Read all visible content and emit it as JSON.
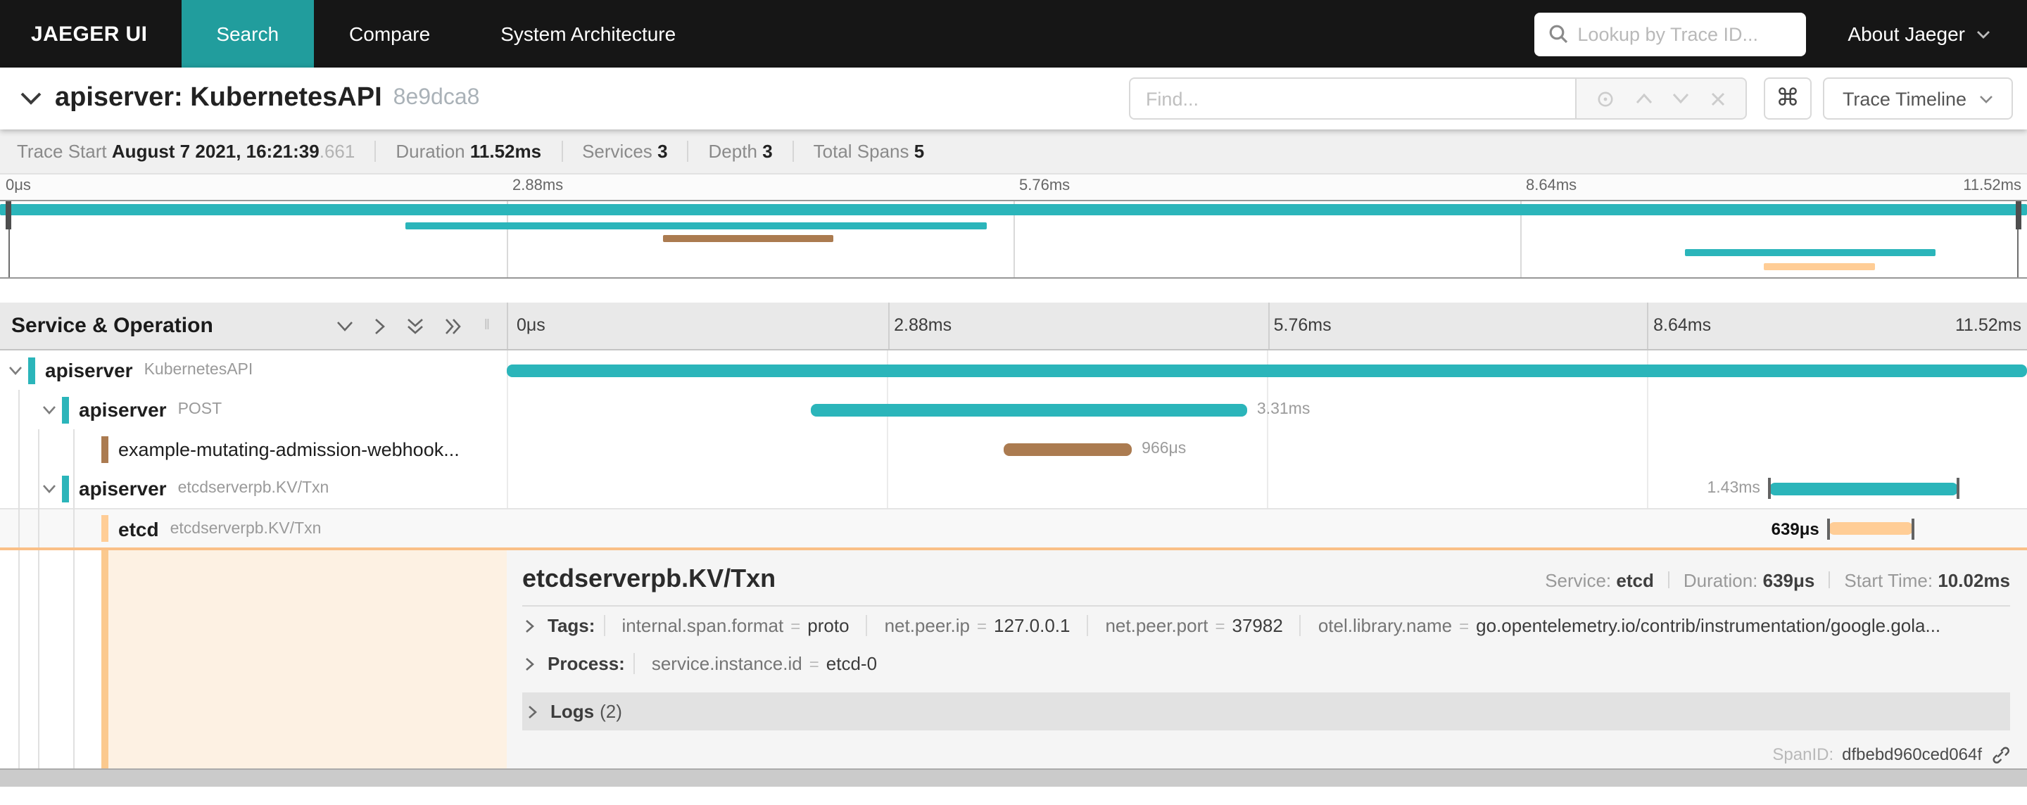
{
  "nav": {
    "logo": "JAEGER UI",
    "tabs": [
      {
        "label": "Search",
        "active": true
      },
      {
        "label": "Compare",
        "active": false
      },
      {
        "label": "System Architecture",
        "active": false
      }
    ],
    "lookup_placeholder": "Lookup by Trace ID...",
    "about_label": "About Jaeger"
  },
  "trace_header": {
    "title": "apiserver: KubernetesAPI",
    "trace_id": "8e9dca8",
    "find_placeholder": "Find...",
    "shortcut": "⌘",
    "view_selector": "Trace Timeline"
  },
  "summary": {
    "trace_start_label": "Trace Start",
    "trace_start_value": "August 7 2021, 16:21:39",
    "trace_start_fraction": ".661",
    "duration_label": "Duration",
    "duration_value": "11.52ms",
    "services_label": "Services",
    "services_value": "3",
    "depth_label": "Depth",
    "depth_value": "3",
    "total_spans_label": "Total Spans",
    "total_spans_value": "5"
  },
  "timeline": {
    "ticks": [
      "0μs",
      "2.88ms",
      "5.76ms",
      "8.64ms",
      "11.52ms"
    ]
  },
  "span_table": {
    "header": "Service & Operation"
  },
  "spans": [
    {
      "service": "apiserver",
      "operation": "KubernetesAPI",
      "color": "#2bb5ba",
      "start_ms": 0,
      "duration_ms": 11.52,
      "duration_label": "",
      "bar_style": "left:0%;width:100%;background:#2bb5ba",
      "colorbar_style": "background:#2bb5ba"
    },
    {
      "service": "apiserver",
      "operation": "POST",
      "color": "#2bb5ba",
      "start_ms": 2.3,
      "duration_ms": 3.31,
      "duration_label": "3.31ms",
      "bar_style": "left:19.97%;width:28.73%;background:#2bb5ba",
      "colorbar_style": "background:#2bb5ba"
    },
    {
      "service": "example-mutating-admission-webhook...",
      "operation": "",
      "color": "#ab7b50",
      "start_ms": 3.77,
      "duration_ms": 0.966,
      "duration_label": "966μs",
      "bar_style": "left:32.73%;width:8.39%;background:#ab7b50",
      "colorbar_style": "background:#ab7b50"
    },
    {
      "service": "apiserver",
      "operation": "etcdserverpb.KV/Txn",
      "color": "#2bb5ba",
      "start_ms": 9.58,
      "duration_ms": 1.43,
      "duration_label": "1.43ms",
      "bar_style": "left:83.1%;width:12.41%;background:#2bb5ba",
      "colorbar_style": "background:#2bb5ba"
    },
    {
      "service": "etcd",
      "operation": "etcdserverpb.KV/Txn",
      "color": "#ffcd96",
      "start_ms": 10.02,
      "duration_ms": 0.639,
      "duration_label": "639μs",
      "bar_style": "left:86.98%;width:5.55%;background:#ffcd96",
      "colorbar_style": "background:#ffcd96"
    }
  ],
  "detail": {
    "title": "etcdserverpb.KV/Txn",
    "service_label": "Service:",
    "service": "etcd",
    "duration_label": "Duration:",
    "duration": "639μs",
    "start_label": "Start Time:",
    "start": "10.02ms",
    "tags_label": "Tags:",
    "tags": [
      {
        "key": "internal.span.format",
        "value": "proto"
      },
      {
        "key": "net.peer.ip",
        "value": "127.0.0.1"
      },
      {
        "key": "net.peer.port",
        "value": "37982"
      },
      {
        "key": "otel.library.name",
        "value": "go.opentelemetry.io/contrib/instrumentation/google.gola..."
      }
    ],
    "process_label": "Process:",
    "process": [
      {
        "key": "service.instance.id",
        "value": "etcd-0"
      }
    ],
    "logs_label": "Logs",
    "logs_count": "(2)",
    "span_id_label": "SpanID:",
    "span_id": "dfbebd960ced064f"
  }
}
